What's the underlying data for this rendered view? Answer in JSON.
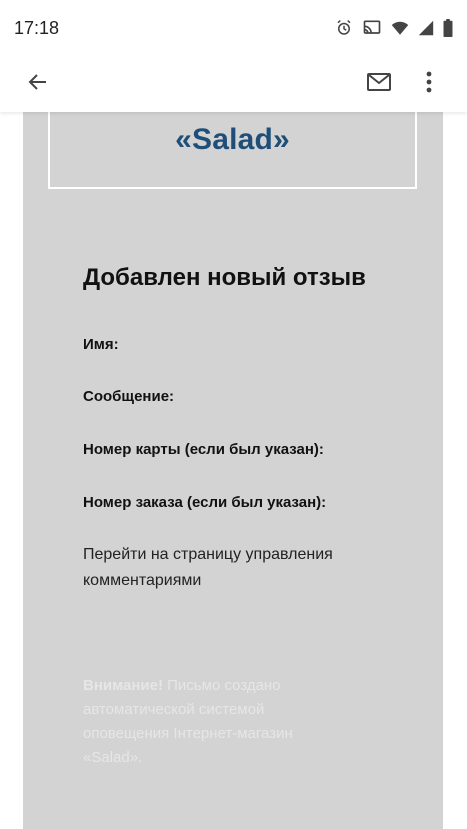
{
  "status_bar": {
    "time": "17:18",
    "icons": [
      "alarm-icon",
      "cast-icon",
      "wifi-icon",
      "cellular-signal-icon",
      "battery-icon"
    ]
  },
  "app_bar": {
    "icons": [
      "back-arrow-icon",
      "mail-icon",
      "more-vert-icon"
    ]
  },
  "email": {
    "logo_text": "«Salad»",
    "heading": "Добавлен новый отзыв",
    "fields": {
      "name": "Имя:",
      "message": "Сообщение:",
      "card_number": "Номер карты (если был указан):",
      "order_number": "Номер заказа (если был указан):"
    },
    "manage_link": "Перейти на страницу управления комментариями",
    "notice_bold": "Внимание!",
    "notice_text": " Письмо создано автоматической системой оповещения Інтернет-магазин «Salad»."
  },
  "colors": {
    "card_bg": "#d3d3d3",
    "logo": "#1f4e78",
    "notice": "#e6e6e6"
  }
}
